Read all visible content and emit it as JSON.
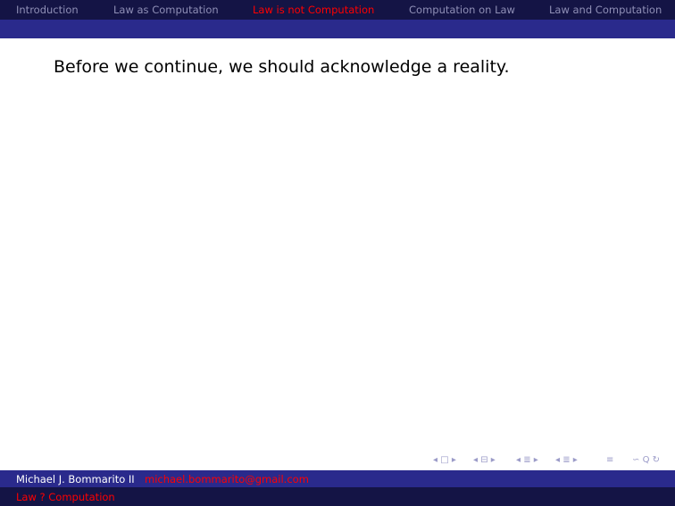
{
  "nav": {
    "items": [
      {
        "label": "Introduction"
      },
      {
        "label": "Law as Computation"
      },
      {
        "label": "Law is not Computation"
      },
      {
        "label": "Computation on Law"
      },
      {
        "label": "Law and Computation"
      }
    ],
    "active_index": 2,
    "colors": {
      "inactive": "#8f8fb6",
      "active": "#ff0000",
      "bar_dark": "#141445",
      "bar_mid": "#2a2a8c"
    }
  },
  "slide": {
    "text": "Before we continue, we should acknowledge a reality."
  },
  "footer": {
    "author": "Michael J. Bommarito II",
    "email": "michael.bommarito@gmail.com",
    "short_title": "Law ? Computation"
  },
  "nav_symbols": {
    "frame_prev": "◂",
    "frame_icon": "□",
    "frame_next": "▸",
    "subsection_prev": "◂",
    "subsection_icon": "⊟",
    "subsection_next": "▸",
    "section_prev": "◂",
    "section_icon": "≣",
    "section_next": "▸",
    "section2_prev": "◂",
    "section2_icon": "≣",
    "section2_next": "▸",
    "align_icon": "≡",
    "search_icon": "∽",
    "zoom_icon": "Q",
    "back_icon": "↻"
  }
}
